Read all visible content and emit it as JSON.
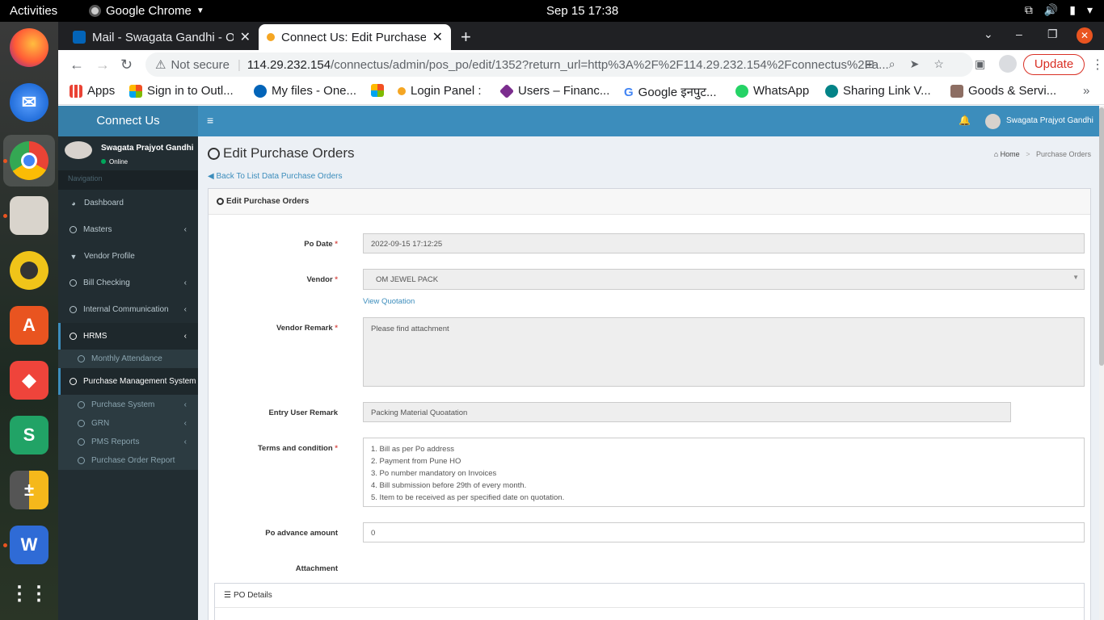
{
  "topbar": {
    "activities": "Activities",
    "app_name": "Google Chrome",
    "clock": "Sep 15  17:38"
  },
  "dock": {
    "items": [
      "firefox-icon",
      "thunderbird-icon",
      "chrome-icon",
      "files-icon",
      "rhythmbox-icon",
      "software-icon",
      "anydesk-icon",
      "sheets-icon",
      "calculator-icon",
      "wps-icon",
      "app-grid-icon"
    ],
    "accent": "#e95420"
  },
  "tabs": [
    {
      "title": "Mail - Swagata Gandhi - Ou"
    },
    {
      "title": "Connect Us: Edit Purchase"
    }
  ],
  "toolbar": {
    "not_secure": "Not secure",
    "url_host": "114.29.232.154",
    "url_path": "/connectus/admin/pos_po/edit/1352?return_url=http%3A%2F%2F114.29.232.154%2Fconnectus%2Fa...",
    "update": "Update"
  },
  "bookmarks": [
    {
      "label": "Apps",
      "color": "#ea4335"
    },
    {
      "label": "Sign in to Outl...",
      "color": "#f25022"
    },
    {
      "label": "My files - One...",
      "color": "#0364b8"
    },
    {
      "label": "",
      "color": "#7fba00"
    },
    {
      "label": "Login Panel :",
      "color": "#f5a623"
    },
    {
      "label": "Users – Financ...",
      "color": "#7b2d8e"
    },
    {
      "label": "Google इनपुट...",
      "color": "#4285f4"
    },
    {
      "label": "WhatsApp",
      "color": "#25d366"
    },
    {
      "label": "Sharing Link V...",
      "color": "#038387"
    },
    {
      "label": "Goods & Servi...",
      "color": "#8d6e63"
    }
  ],
  "sidebar": {
    "logo": "Connect Us",
    "user_name": "Swagata Prajyot Gandhi",
    "status": "Online",
    "nav_header": "Navigation",
    "menu": [
      {
        "label": "Dashboard",
        "icon": "dashboard-icon"
      },
      {
        "label": "Masters",
        "icon": "circle-icon"
      },
      {
        "label": "Vendor Profile",
        "icon": "filter-icon"
      },
      {
        "label": "Bill Checking",
        "icon": "circle-icon"
      },
      {
        "label": "Internal Communication",
        "icon": "circle-icon"
      },
      {
        "label": "HRMS",
        "icon": "circle-icon"
      },
      {
        "label": "Monthly Attendance",
        "icon": "circle-icon"
      },
      {
        "label": "Purchase Management System",
        "icon": "circle-icon"
      },
      {
        "label": "Purchase System",
        "icon": "circle-icon"
      },
      {
        "label": "GRN",
        "icon": "circle-icon"
      },
      {
        "label": "PMS Reports",
        "icon": "circle-icon"
      },
      {
        "label": "Purchase Order Report",
        "icon": "circle-icon"
      }
    ]
  },
  "header": {
    "user_name": "Swagata Prajyot Gandhi"
  },
  "page": {
    "title": "Edit Purchase Orders",
    "breadcrumb_home": "Home",
    "breadcrumb_current": "Purchase Orders",
    "back_link": "Back To List Data Purchase Orders",
    "box_title": "Edit Purchase Orders"
  },
  "form": {
    "po_date_label": "Po Date",
    "po_date": "2022-09-15 17:12:25",
    "vendor_label": "Vendor",
    "vendor": "OM JEWEL PACK",
    "view_quotation": "View Quotation",
    "vendor_remark_label": "Vendor Remark",
    "vendor_remark": "Please find attachment",
    "entry_user_remark_label": "Entry User Remark",
    "entry_user_remark": "Packing Material Quoatation",
    "terms_label": "Terms and condition",
    "terms": [
      "1. Bill as per Po address",
      "2. Payment from Pune HO",
      "3. Po number mandatory on Invoices",
      "4. Bill submission before 29th of every month.",
      "5. Item to be received as per specified date on quotation."
    ],
    "advance_label": "Po advance amount",
    "advance": "0",
    "attachment_label": "Attachment",
    "required_mark": "*"
  },
  "po_details": {
    "title": "PO Details"
  }
}
